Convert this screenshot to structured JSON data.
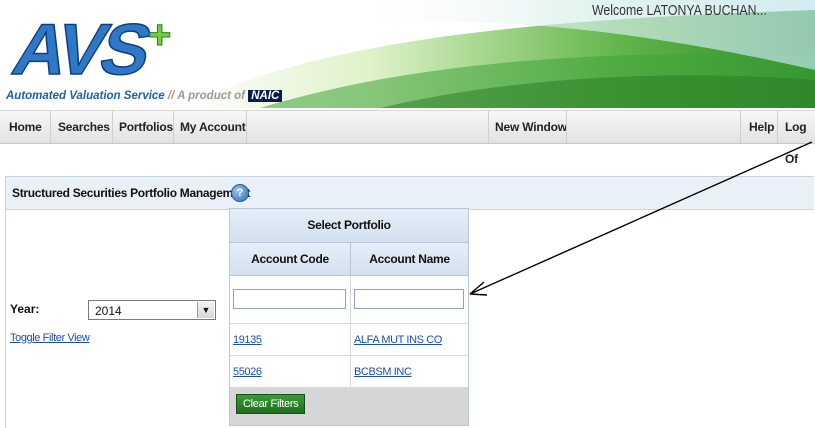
{
  "header": {
    "logo_text": "AVS+",
    "tagline_blue": "Automated Valuation Service",
    "tagline_sep": "//",
    "tagline_product": "A product of",
    "tagline_brand": "NAIC",
    "welcome": "Welcome LATONYA BUCHAN..."
  },
  "nav": {
    "home": "Home",
    "searches": "Searches",
    "portfolios": "Portfolios",
    "my_account": "My Account",
    "new_window": "New Window",
    "help": "Help",
    "log_off": "Log Of"
  },
  "panel": {
    "title": "Structured Securities Portfolio Management",
    "help_icon_glyph": "?"
  },
  "filters": {
    "year_label": "Year:",
    "year_value": "2014",
    "toggle_link": "Toggle Filter View"
  },
  "portfolio_table": {
    "caption": "Select Portfolio",
    "columns": [
      "Account Code",
      "Account Name"
    ],
    "rows": [
      {
        "code": "19135",
        "name": "ALFA MUT INS CO"
      },
      {
        "code": "55026",
        "name": "BCBSM INC"
      }
    ],
    "clear_button": "Clear Filters"
  },
  "colors": {
    "accent_green": "#6fcf3f",
    "logo_blue": "#1a5fb4",
    "link_blue": "#1a4fb8",
    "button_green": "#2d8a2d"
  }
}
